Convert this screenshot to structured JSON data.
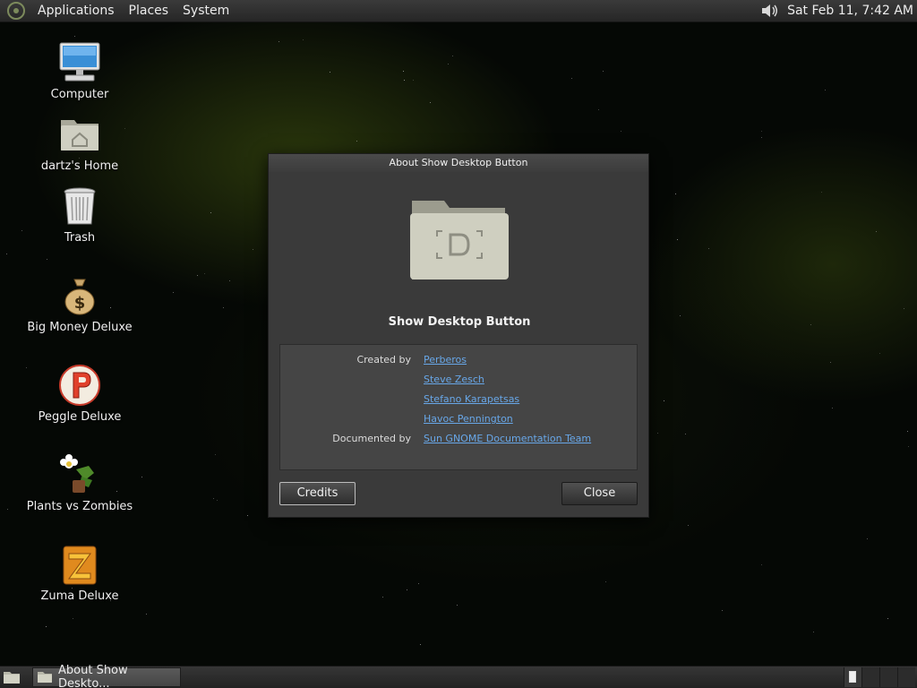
{
  "top_panel": {
    "menus": [
      "Applications",
      "Places",
      "System"
    ],
    "clock": "Sat Feb 11,  7:42 AM",
    "volume_icon": "speaker-icon"
  },
  "desktop_icons": [
    {
      "label": "Computer",
      "icon": "computer-icon"
    },
    {
      "label": "dartz's Home",
      "icon": "home-folder-icon"
    },
    {
      "label": "Trash",
      "icon": "trash-icon"
    },
    {
      "label": "Big Money Deluxe",
      "icon": "money-bag-icon"
    },
    {
      "label": "Peggle Deluxe",
      "icon": "peggle-icon"
    },
    {
      "label": "Plants vs Zombies",
      "icon": "plants-vs-zombies-icon"
    },
    {
      "label": "Zuma Deluxe",
      "icon": "zuma-icon"
    }
  ],
  "dialog": {
    "title": "About Show Desktop Button",
    "app_name": "Show Desktop Button",
    "created_by_label": "Created by",
    "authors": [
      "Perberos",
      "Steve Zesch",
      "Stefano Karapetsas",
      "Havoc Pennington"
    ],
    "documented_by_label": "Documented by",
    "documenters": [
      "Sun GNOME Documentation Team"
    ],
    "credits_button": "Credits",
    "close_button": "Close"
  },
  "bottom_panel": {
    "task_label": "About Show Deskto..."
  },
  "colors": {
    "link": "#68a7e8",
    "dialog_bg": "#3a3a3a",
    "panel_bg": "#2b2b2b"
  }
}
